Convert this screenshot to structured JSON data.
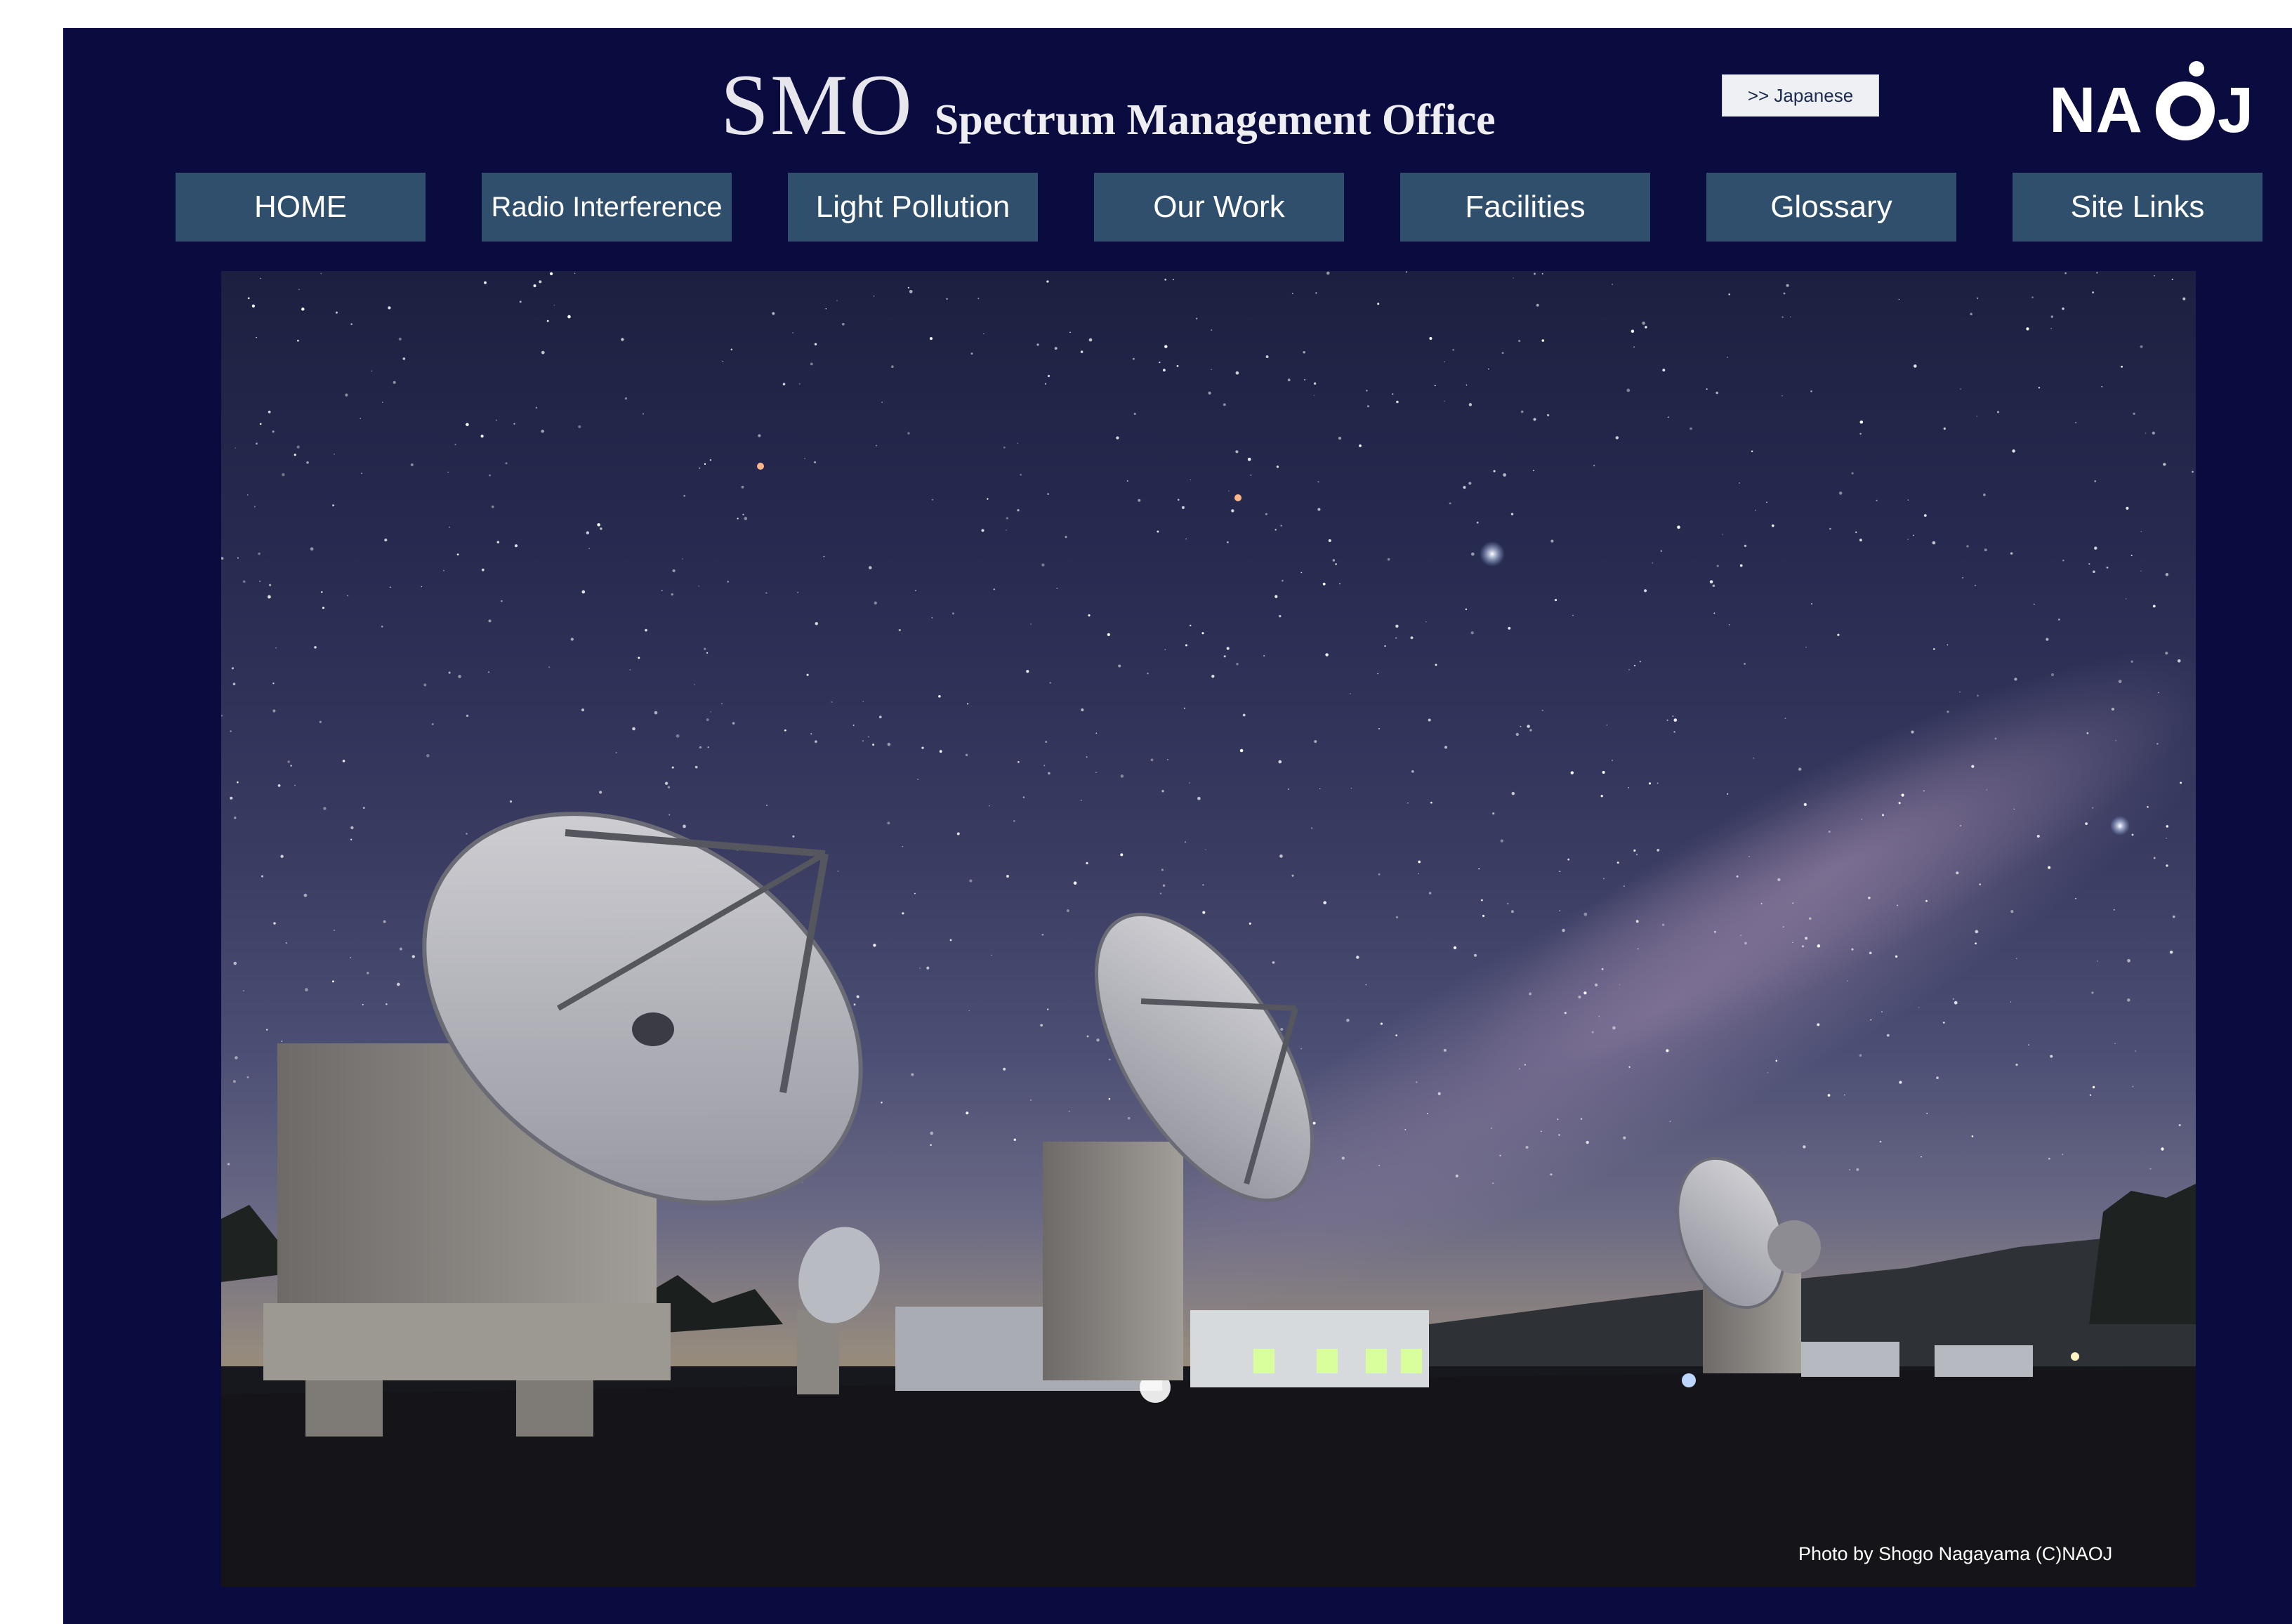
{
  "header": {
    "abbr": "SMO",
    "title": "Spectrum Management Office",
    "language_button": ">> Japanese",
    "logo_text": "NAOJ"
  },
  "nav": {
    "items": [
      {
        "label": "HOME"
      },
      {
        "label": "Radio Interference"
      },
      {
        "label": "Light Pollution"
      },
      {
        "label": "Our Work"
      },
      {
        "label": "Facilities"
      },
      {
        "label": "Glossary"
      },
      {
        "label": "Site Links"
      }
    ]
  },
  "hero": {
    "caption": "Photo by Shogo Nagayama (C)NAOJ"
  },
  "colors": {
    "page_background": "#0a0b3f",
    "nav_button": "#2f4f6d",
    "nav_text": "#ffffff"
  }
}
